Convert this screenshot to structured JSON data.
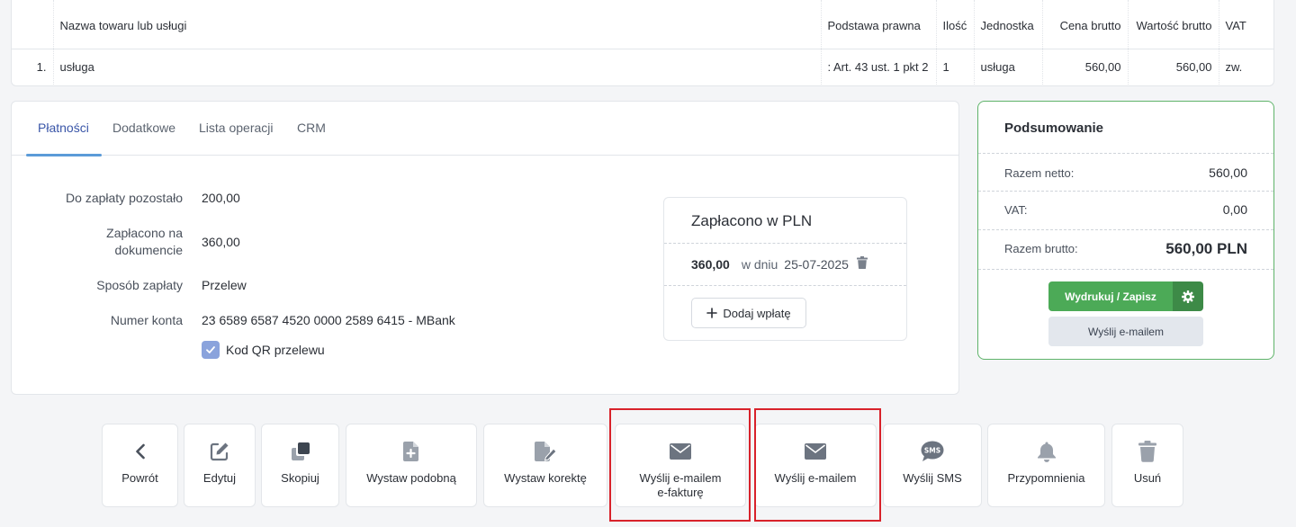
{
  "items_table": {
    "headers": [
      "",
      "Nazwa towaru lub usługi",
      "Podstawa prawna",
      "Ilość",
      "Jednostka",
      "Cena brutto",
      "Wartość brutto",
      "VAT"
    ],
    "rows": [
      [
        "1.",
        "usługa",
        ": Art. 43 ust. 1 pkt 2",
        "1",
        "usługa",
        "560,00",
        "560,00",
        "zw."
      ]
    ]
  },
  "tabs": [
    "Płatności",
    "Dodatkowe",
    "Lista operacji",
    "CRM"
  ],
  "payment": {
    "remaining_label": "Do zapłaty pozostało",
    "remaining_value": "200,00",
    "paid_label": "Zapłacono na dokumencie",
    "paid_value": "360,00",
    "method_label": "Sposób zapłaty",
    "method_value": "Przelew",
    "account_label": "Numer konta",
    "account_value": "23 6589 6587 4520 0000 2589 6415 - MBank",
    "qr_label": "Kod QR przelewu",
    "qr_checked": true
  },
  "paid_box": {
    "title": "Zapłacono w PLN",
    "amount": "360,00",
    "in_day": "w dniu",
    "date": "25-07-2025",
    "add_label": "Dodaj wpłatę"
  },
  "summary": {
    "title": "Podsumowanie",
    "net_label": "Razem netto:",
    "net_value": "560,00",
    "vat_label": "VAT:",
    "vat_value": "0,00",
    "gross_label": "Razem brutto:",
    "gross_value": "560,00 PLN",
    "print_label": "Wydrukuj / Zapisz",
    "email_label": "Wyślij e-mailem"
  },
  "actions": {
    "back": "Powrót",
    "edit": "Edytuj",
    "copy": "Skopiuj",
    "similar": "Wystaw podobną",
    "correction": "Wystaw korektę",
    "einvoice_line1": "Wyślij e-mailem",
    "einvoice_line2": "e-fakturę",
    "email": "Wyślij e-mailem",
    "sms": "Wyślij SMS",
    "reminders": "Przypomnienia",
    "delete": "Usuń",
    "sms_icon_text": "SMS"
  },
  "colors": {
    "accent": "#3a56a8",
    "primary_green": "#4caa57",
    "highlight_red": "#d8222b",
    "icon_gray": "#6c7480"
  }
}
